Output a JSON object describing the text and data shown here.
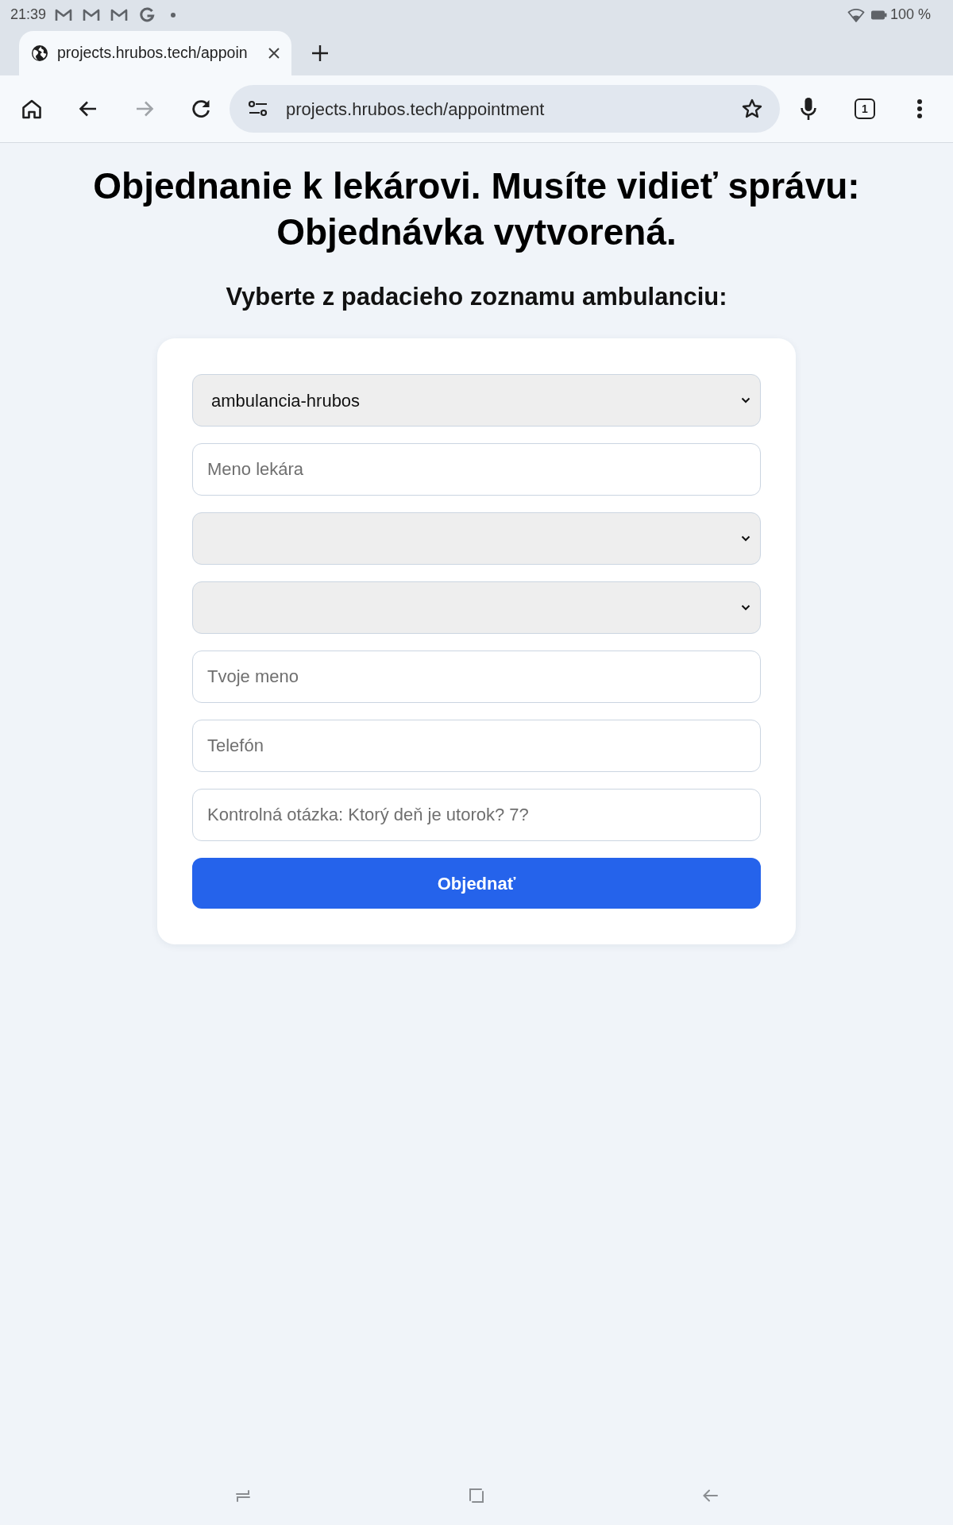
{
  "status_bar": {
    "time": "21:39",
    "battery": "100 %"
  },
  "browser": {
    "tab": {
      "title": "projects.hrubos.tech/appoin"
    },
    "toolbar": {
      "back": {
        "disabled": false
      },
      "forward": {
        "disabled": true
      },
      "url": "projects.hrubos.tech/appointment",
      "tab_count": "1"
    }
  },
  "page": {
    "heading": "Objednanie k lekárovi. Musíte vidieť správu: Objednávka vytvorená.",
    "subheading": "Vyberte z padacieho zoznamu ambulanciu:",
    "form": {
      "fields": [
        {
          "kind": "select",
          "value": "ambulancia-hrubos"
        },
        {
          "kind": "input",
          "placeholder": "Meno lekára"
        },
        {
          "kind": "select"
        },
        {
          "kind": "select"
        },
        {
          "kind": "input",
          "placeholder": "Tvoje meno"
        },
        {
          "kind": "input",
          "placeholder": "Telefón"
        },
        {
          "kind": "input",
          "placeholder": "Kontrolná otázka: Ktorý deň je utorok? 7?"
        }
      ],
      "submit": "Objednať"
    }
  }
}
